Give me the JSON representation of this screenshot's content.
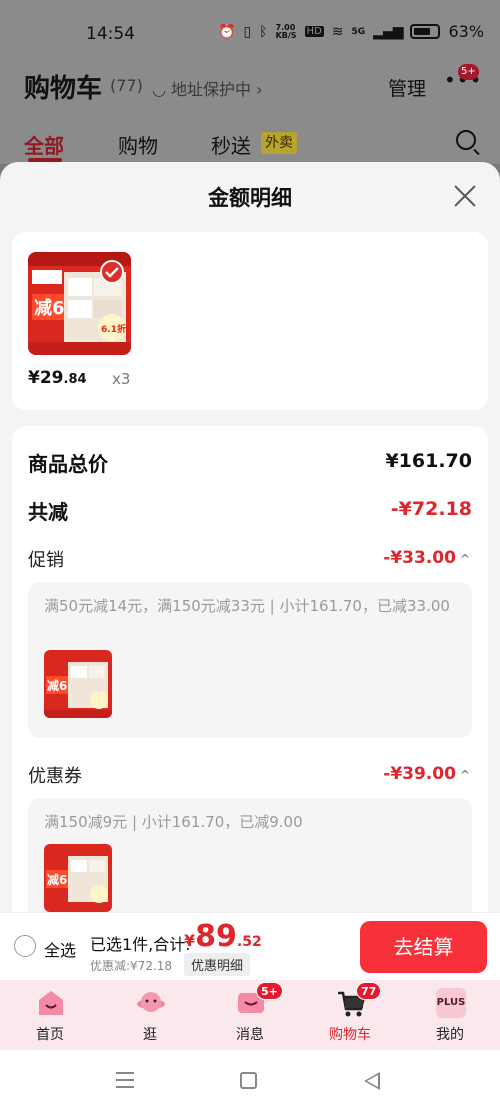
{
  "status_bar": {
    "time": "14:54",
    "network_speed": "7.00\nKB/S",
    "hd": "HD",
    "signal": "5G",
    "battery": "63%"
  },
  "background_header": {
    "title": "购物车",
    "count": "(77)",
    "address": "地址保护中 ›",
    "manage": "管理",
    "more_badge": "5+",
    "tabs": [
      {
        "label": "全部",
        "active": true
      },
      {
        "label": "购物"
      },
      {
        "label": "秒送"
      }
    ],
    "takeout_tag": "外卖"
  },
  "sheet": {
    "title": "金额明细",
    "item": {
      "price_symbol": "¥",
      "price_int": "29",
      "price_dec": ".84",
      "quantity": "x3"
    },
    "total_label": "商品总价",
    "total_value": "¥161.70",
    "reduce_label": "共减",
    "reduce_value": "-¥72.18",
    "promo": {
      "label": "促销",
      "value": "-¥33.00",
      "desc": "满50元减14元，满150元减33元 | 小计161.70，已减33.00"
    },
    "coupon": {
      "label": "优惠券",
      "value": "-¥39.00",
      "desc": "满150减9元 | 小计161.70，已减9.00"
    }
  },
  "checkout": {
    "select_all": "全选",
    "selected_text": "已选1件,合计:",
    "total_symbol": "¥",
    "total_int": "89",
    "total_dec": ".52",
    "discount_text": "优惠减:¥72.18",
    "detail_button": "优惠明细",
    "pay_button": "去结算"
  },
  "tabbar": [
    {
      "label": "首页",
      "icon": "home-icon"
    },
    {
      "label": "逛",
      "icon": "explore-icon"
    },
    {
      "label": "消息",
      "icon": "message-icon",
      "badge": "5+"
    },
    {
      "label": "购物车",
      "icon": "cart-icon",
      "badge": "77",
      "active": true
    },
    {
      "label": "我的",
      "icon": "plus-member-icon",
      "icon_text": "PLUS"
    }
  ],
  "colors": {
    "accent": "#e0262c",
    "pay_button": "#f8303a",
    "tabbar_bg": "#fbe8ec"
  }
}
